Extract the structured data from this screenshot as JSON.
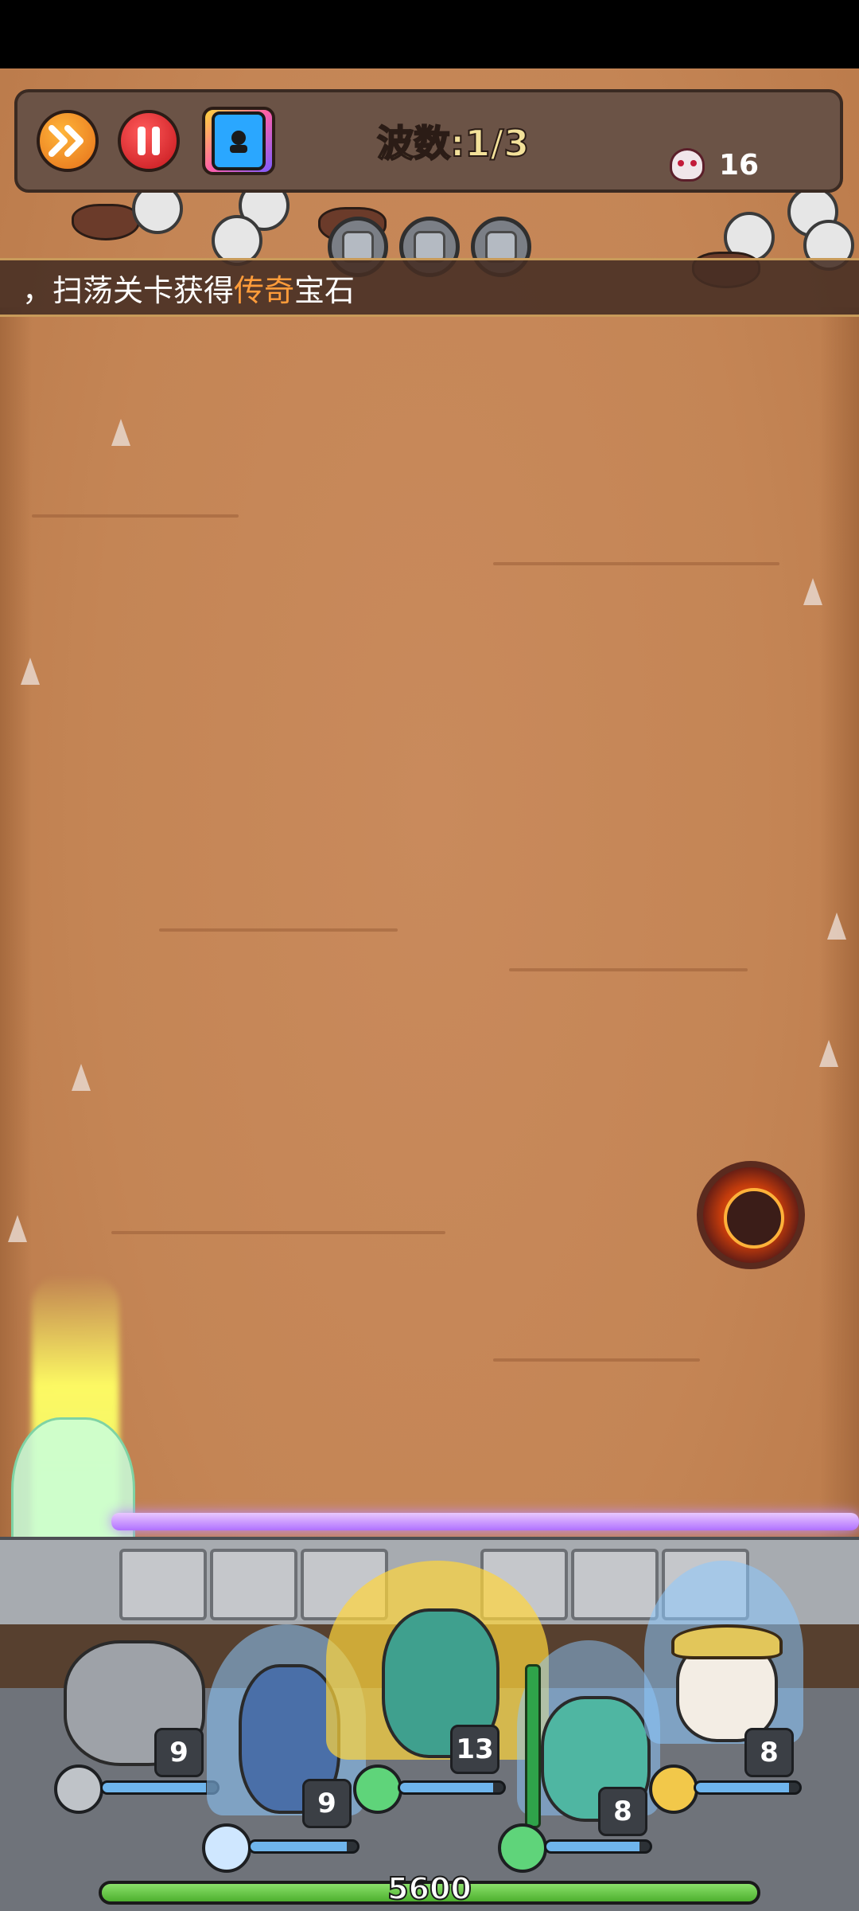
{
  "hud": {
    "wave_label": "波数:1/3",
    "enemy_count": "16"
  },
  "banner": {
    "prefix": "，扫荡关卡获得",
    "highlight": "传奇",
    "suffix": "宝石"
  },
  "heroes": [
    {
      "name": "stone-golem",
      "level": "9",
      "hp_fraction": 0.9,
      "element": "rock"
    },
    {
      "name": "ice-knight",
      "level": "9",
      "hp_fraction": 0.9,
      "element": "ice"
    },
    {
      "name": "wind-spirit",
      "level": "13",
      "hp_fraction": 0.9,
      "element": "wind"
    },
    {
      "name": "deer-druid",
      "level": "8",
      "hp_fraction": 0.9,
      "element": "wind"
    },
    {
      "name": "panda-monk",
      "level": "8",
      "hp_fraction": 0.9,
      "element": "gold"
    }
  ],
  "base": {
    "hp": "5600",
    "hp_fraction": 1.0
  },
  "colors": {
    "field": "#c48555",
    "highlight": "#ff9c3a",
    "hp_fill": "#6fb5ec",
    "base_fill": "#4db02e"
  }
}
